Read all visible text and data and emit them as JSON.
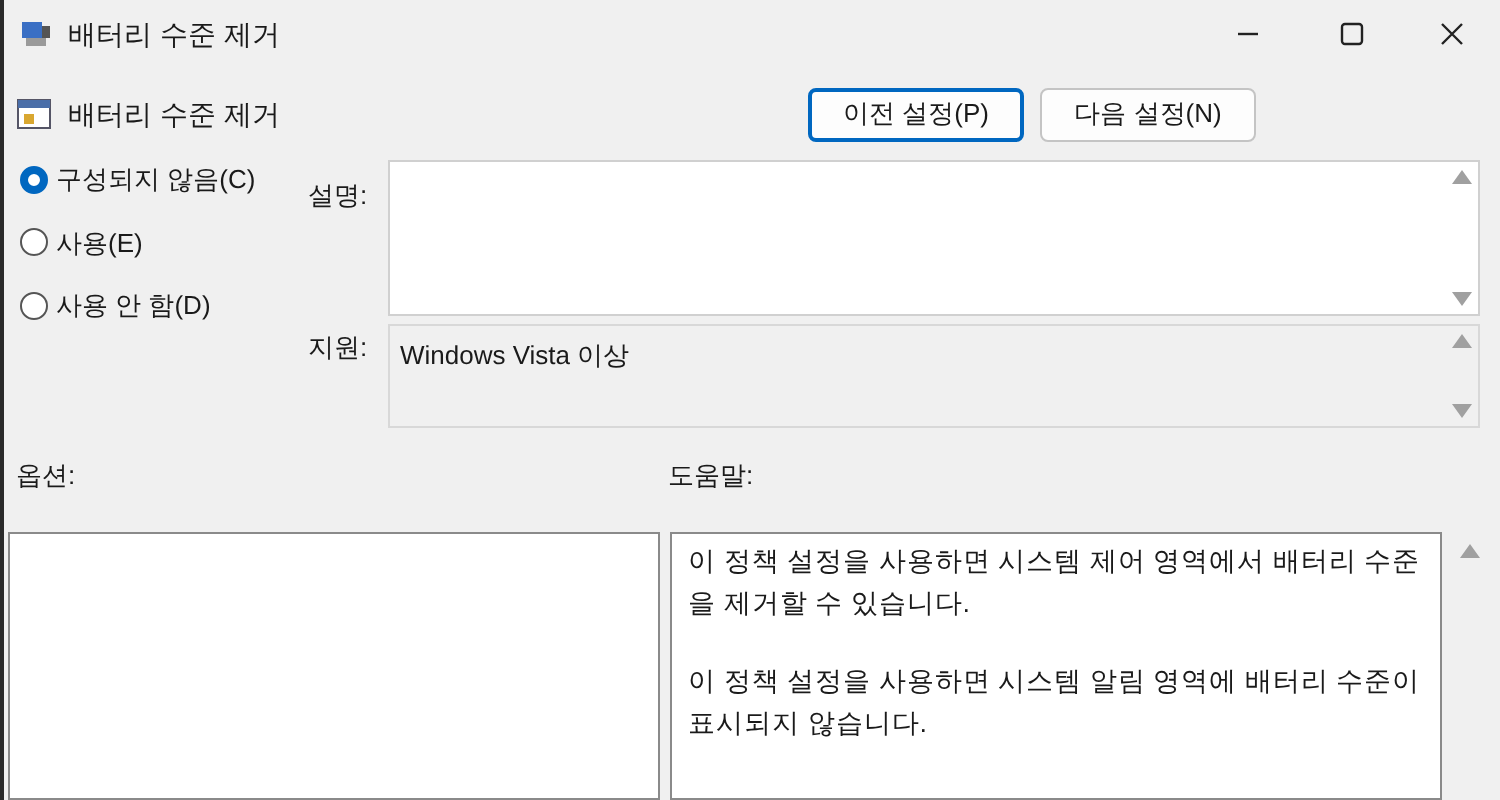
{
  "window": {
    "title": "배터리 수준 제거"
  },
  "header": {
    "title": "배터리 수준 제거",
    "buttons": [
      {
        "label": "이전 설정(P)",
        "selected": true
      },
      {
        "label": "다음 설정(N)",
        "selected": false
      }
    ]
  },
  "radios": [
    {
      "label": "구성되지 않음(C)",
      "selected": true
    },
    {
      "label": "사용(E)",
      "selected": false
    },
    {
      "label": "사용 안 함(D)",
      "selected": false
    }
  ],
  "comment": {
    "label": "설명:"
  },
  "supported": {
    "label": "지원:",
    "value": "Windows Vista 이상"
  },
  "options": {
    "label": "옵션:"
  },
  "help": {
    "label": "도움말:",
    "paragraphs": [
      "이 정책 설정을 사용하면 시스템 제어 영역에서 배터리 수준을 제거할 수 있습니다.",
      "이 정책 설정을 사용하면 시스템 알림 영역에 배터리 수준이 표시되지 않습니다."
    ]
  }
}
